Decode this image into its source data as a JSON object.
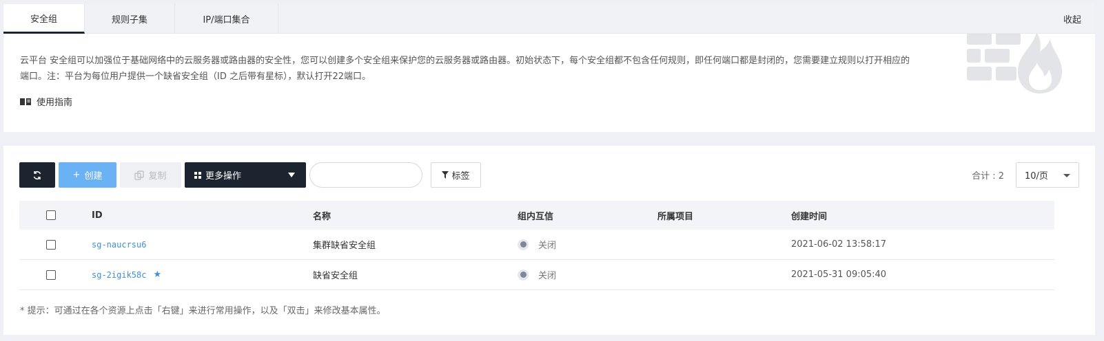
{
  "tabs": {
    "items": [
      {
        "label": "安全组"
      },
      {
        "label": "规则子集"
      },
      {
        "label": "IP/端口集合"
      }
    ],
    "collapse_label": "收起"
  },
  "intro": {
    "text": "云平台 安全组可以加强位于基础网络中的云服务器或路由器的安全性，您可以创建多个安全组来保护您的云服务器或路由器。初始状态下，每个安全组都不包含任何规则，即任何端口都是封闭的，您需要建立规则以打开相应的端口。注：平台为每位用户提供一个缺省安全组（ID 之后带有星标），默认打开22端口。",
    "guide_label": "使用指南"
  },
  "toolbar": {
    "create_label": "创建",
    "copy_label": "复制",
    "more_label": "更多操作",
    "search_placeholder": "",
    "tag_label": "标签",
    "total_label": "合计 : 2",
    "page_size": "10/页"
  },
  "table": {
    "headers": {
      "id": "ID",
      "name": "名称",
      "trust": "组内互信",
      "project": "所属项目",
      "created": "创建时间"
    },
    "rows": [
      {
        "id": "sg-naucrsu6",
        "name": "集群缺省安全组",
        "trust": "关闭",
        "project": "",
        "created": "2021-06-02 13:58:17",
        "default": false
      },
      {
        "id": "sg-2igik58c",
        "name": "缺省安全组",
        "trust": "关闭",
        "project": "",
        "created": "2021-05-31 09:05:40",
        "default": true
      }
    ]
  },
  "hint": "* 提示：可通过在各个资源上点击「右键」来进行常用操作，以及「双击」来修改基本属性。",
  "colors": {
    "dark": "#1c2430",
    "accent": "#6ab2f3",
    "link": "#3f8fd8"
  }
}
